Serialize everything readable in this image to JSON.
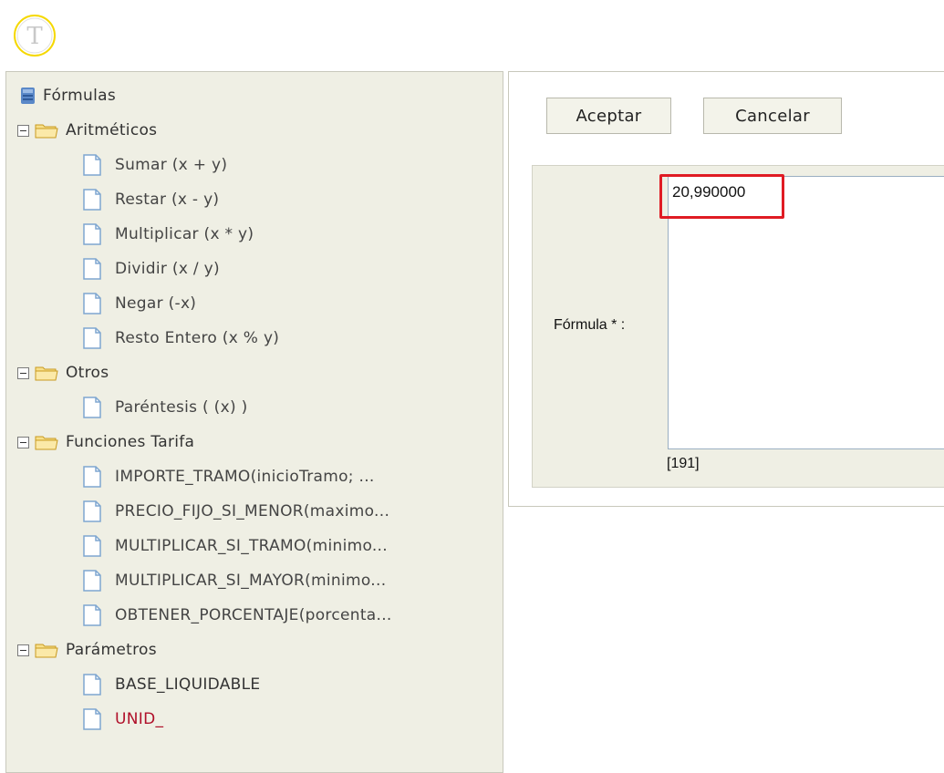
{
  "logo": {
    "letter": "T"
  },
  "tree": {
    "root": "Fórmulas",
    "groups": [
      {
        "label": "Aritméticos",
        "items": [
          "Sumar (x + y)",
          "Restar (x - y)",
          "Multiplicar (x * y)",
          "Dividir (x / y)",
          "Negar (-x)",
          "Resto Entero (x % y)"
        ]
      },
      {
        "label": "Otros",
        "items": [
          "Paréntesis ( (x) )"
        ]
      },
      {
        "label": "Funciones Tarifa",
        "items": [
          "IMPORTE_TRAMO(inicioTramo; ...",
          "PRECIO_FIJO_SI_MENOR(maximo...",
          "MULTIPLICAR_SI_TRAMO(minimo...",
          "MULTIPLICAR_SI_MAYOR(minimo...",
          "OBTENER_PORCENTAJE(porcenta..."
        ]
      },
      {
        "label": "Parámetros",
        "items": [
          "BASE_LIQUIDABLE",
          "UNID_"
        ]
      }
    ]
  },
  "form": {
    "accept_label": "Aceptar",
    "cancel_label": "Cancelar",
    "formula_label": "Fórmula * :",
    "formula_value": "20,990000",
    "char_counter": "[191]"
  },
  "colors": {
    "panel_bg": "#efefe4",
    "highlight": "#e01b24",
    "selected_param": "#b0102a"
  }
}
